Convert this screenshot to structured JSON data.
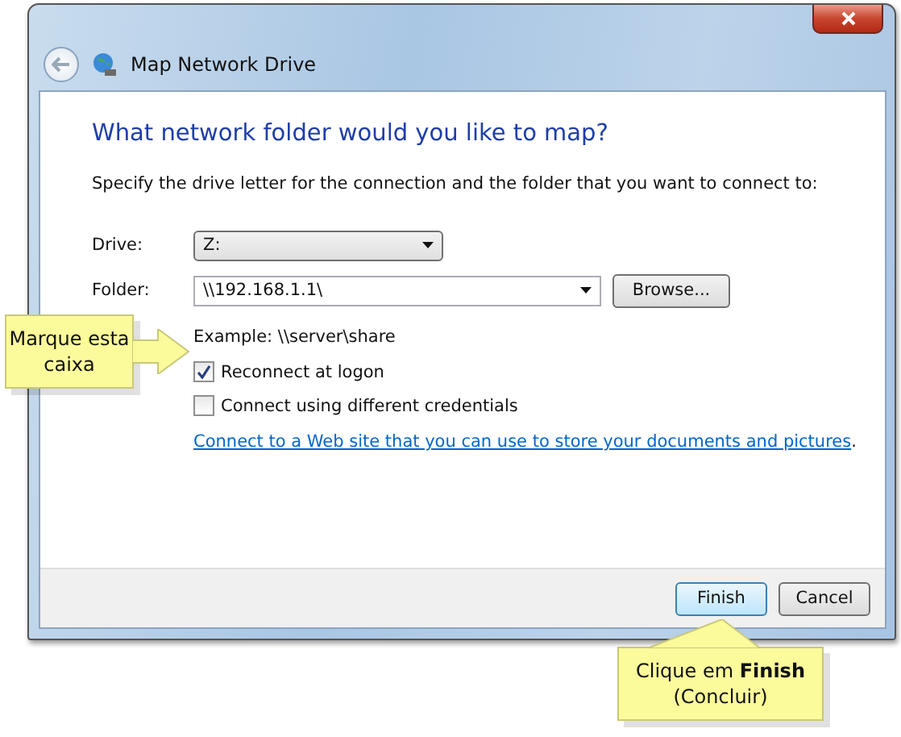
{
  "window": {
    "title": "Map Network Drive"
  },
  "heading": "What network folder would you like to map?",
  "instruction": "Specify the drive letter for the connection and the folder that you want to connect to:",
  "fields": [
    {
      "label": "Drive:",
      "value": "Z:",
      "kind": "dropdown"
    },
    {
      "label": "Folder:",
      "value": "\\\\192.168.1.1\\",
      "kind": "combo"
    }
  ],
  "browse_button": "Browse...",
  "example": "Example: \\\\server\\share",
  "options": [
    {
      "label": "Reconnect at logon",
      "checked": true
    },
    {
      "label": "Connect using different credentials",
      "checked": false
    }
  ],
  "link": "Connect to a Web site that you can use to store your documents and pictures",
  "link_suffix": ".",
  "buttons": [
    {
      "label": "Finish",
      "default": true
    },
    {
      "label": "Cancel",
      "default": false
    }
  ],
  "callouts": [
    {
      "text": "Marque esta caixa"
    },
    {
      "text": "Clique em **Finish** (Concluir)"
    }
  ]
}
